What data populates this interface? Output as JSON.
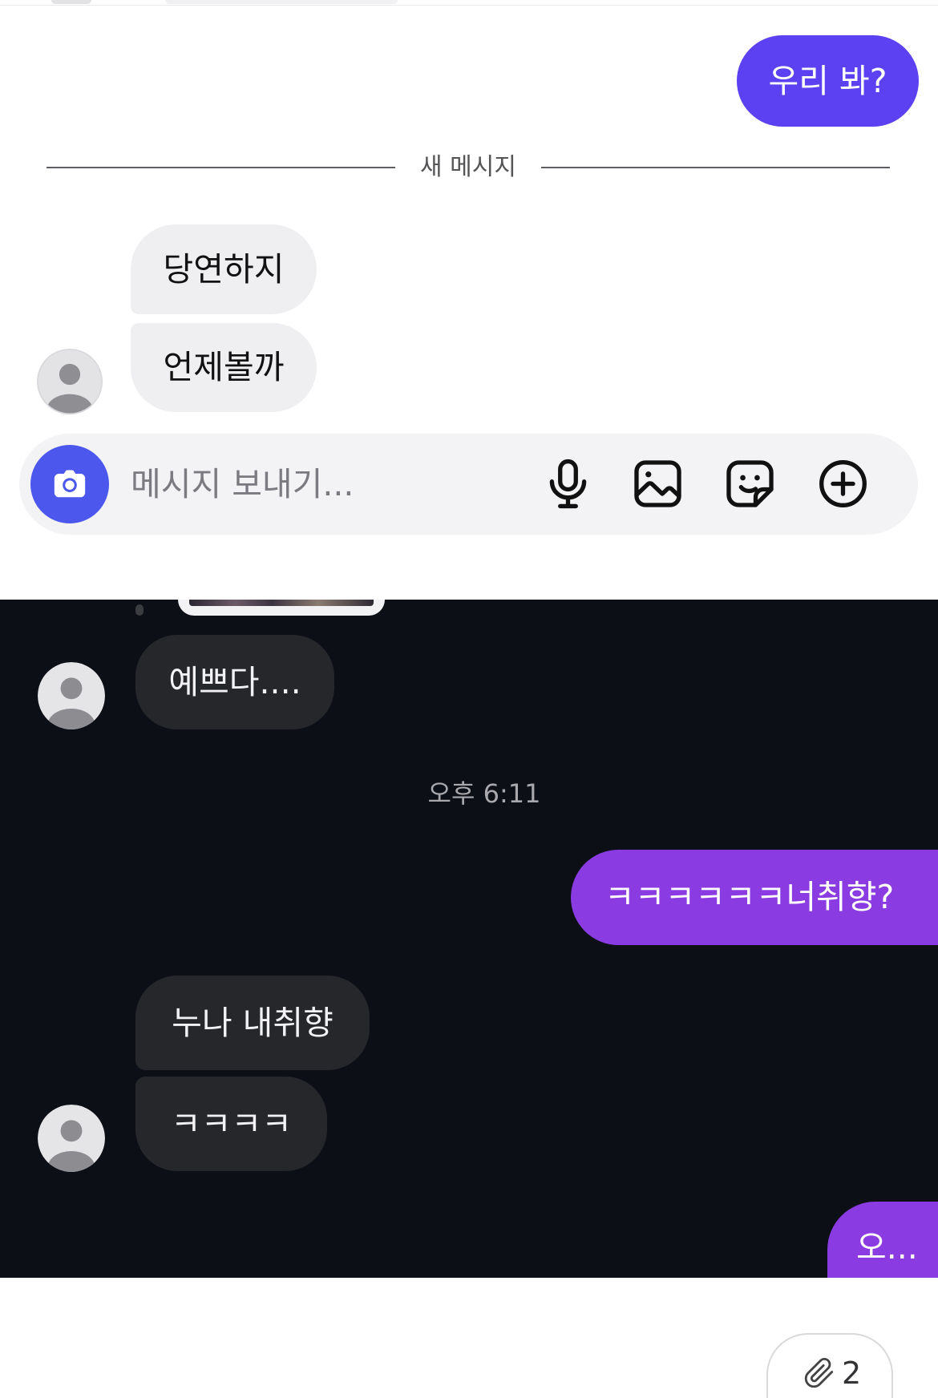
{
  "light_chat": {
    "sent_message": "우리 봐?",
    "new_messages_divider": "새 메시지",
    "received_messages": [
      "당연하지",
      "언제볼까"
    ],
    "avatar_icon": "person-icon",
    "composer": {
      "placeholder": "메시지 보내기...",
      "camera_icon": "camera-icon",
      "action_icons": [
        "microphone-icon",
        "image-icon",
        "sticker-icon",
        "plus-circle-icon"
      ]
    }
  },
  "dark_chat": {
    "received_message": "예쁘다....",
    "timestamp": "오후 6:11",
    "sent_message": "ㅋㅋㅋㅋㅋㅋ너취향?",
    "received_messages": [
      "누나 내취향",
      "ㅋㅋㅋㅋ"
    ],
    "last_sent_message": "오...",
    "avatar_icon": "person-icon"
  },
  "attachment_badge": {
    "icon": "paperclip-icon",
    "count": 2
  },
  "colors": {
    "sent_light": "#5B41F1",
    "camera_button": "#4C57EE",
    "received_light": "#EFEFF2",
    "composer_background": "#F3F3F6",
    "dark_background": "#0C0F15",
    "received_dark": "#26272B",
    "sent_dark": "#8A3BE2"
  }
}
